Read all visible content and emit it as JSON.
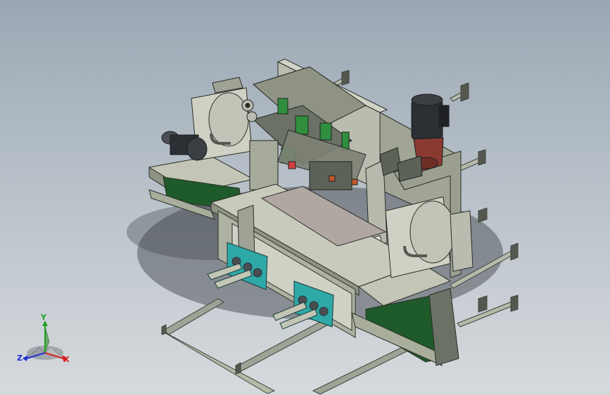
{
  "viewport": {
    "background_top": "#9aa7b3",
    "background_bottom": "#d6dadd"
  },
  "model": {
    "frame_color": "#a8ad9d",
    "panel_color": "#c9cbbf",
    "accent_teal": "#2fa8a8",
    "belt_green": "#1f5a2a",
    "motor_color": "#2c2f33",
    "gearbox_color": "#8a3a30"
  },
  "triad": {
    "x_label": "X",
    "y_label": "Y",
    "z_label": "Z",
    "x_color": "#d42020",
    "y_color": "#20a020",
    "z_color": "#2030d0"
  }
}
